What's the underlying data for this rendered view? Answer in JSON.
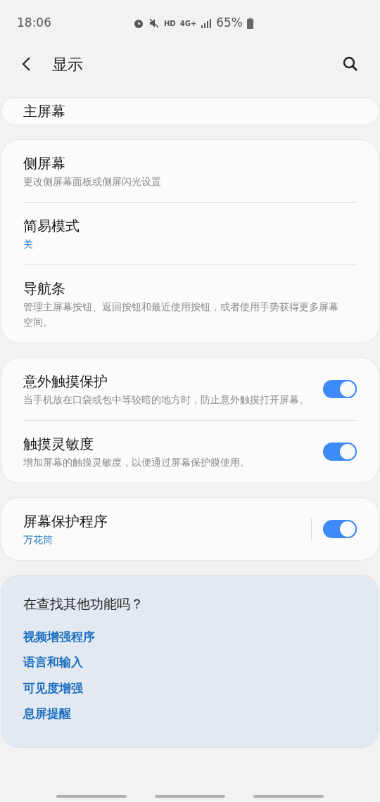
{
  "status_bar": {
    "time": "18:06",
    "hd": "HD",
    "network": "4G+",
    "battery": "65%"
  },
  "header": {
    "title": "显示"
  },
  "groups": [
    {
      "items": [
        {
          "kind": "nav",
          "title": "主屏幕"
        }
      ]
    },
    {
      "items": [
        {
          "kind": "nav",
          "title": "侧屏幕",
          "description": "更改侧屏幕面板或侧屏闪光设置"
        },
        {
          "kind": "nav",
          "title": "简易模式",
          "value": "关"
        },
        {
          "kind": "nav",
          "title": "导航条",
          "description": "管理主屏幕按钮、返回按钮和最近使用按钮，或者使用手势获得更多屏幕空间。"
        }
      ]
    },
    {
      "items": [
        {
          "kind": "toggle",
          "title": "意外触摸保护",
          "description": "当手机放在口袋或包中等较暗的地方时，防止意外触摸打开屏幕。",
          "on": true
        },
        {
          "kind": "toggle",
          "title": "触摸灵敏度",
          "description": "增加屏幕的触摸灵敏度，以便通过屏幕保护膜使用。",
          "on": true
        }
      ]
    },
    {
      "items": [
        {
          "kind": "split-toggle",
          "title": "屏幕保护程序",
          "value": "万花筒",
          "on": true
        }
      ]
    }
  ],
  "suggestions": {
    "title": "在查找其他功能吗？",
    "links": [
      "视频增强程序",
      "语言和输入",
      "可见度增强",
      "息屏提醒"
    ]
  }
}
